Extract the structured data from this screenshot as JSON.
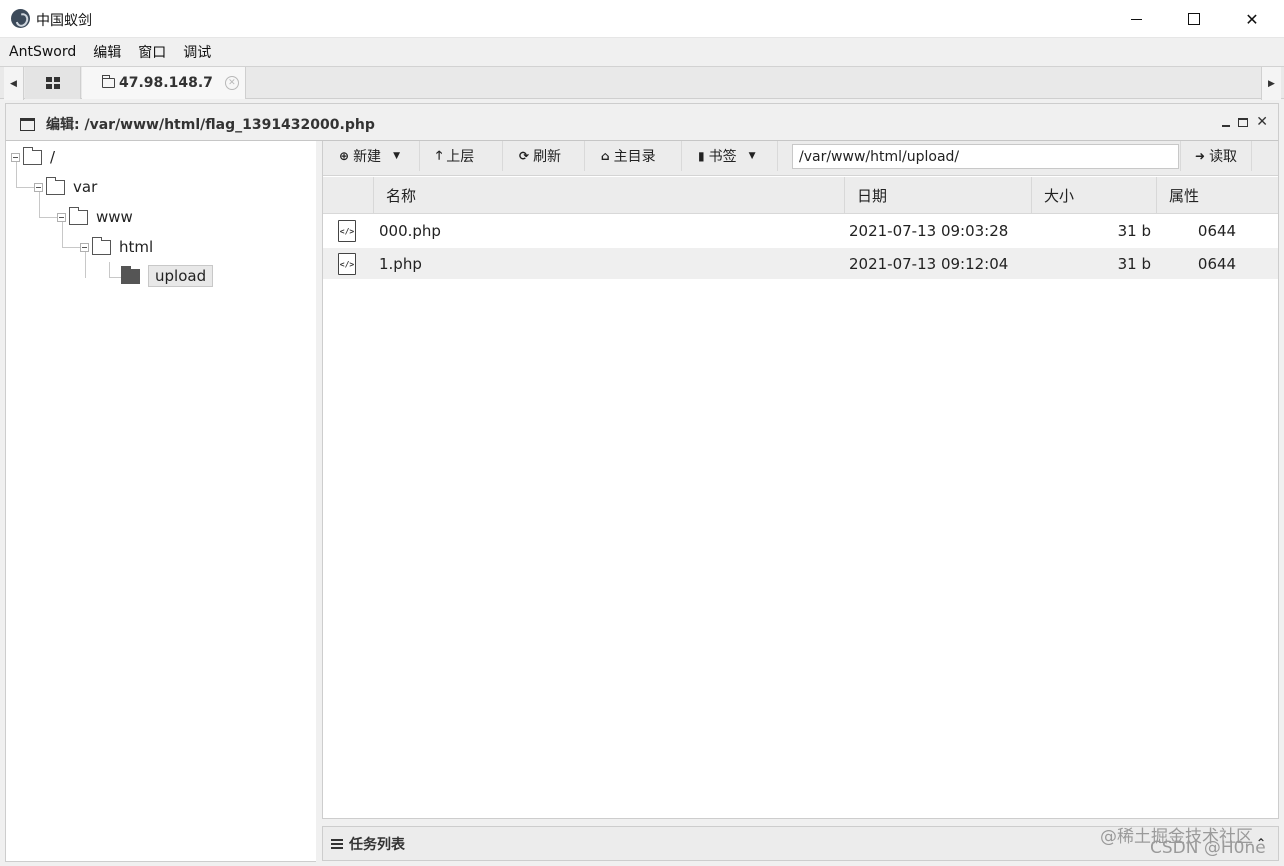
{
  "window": {
    "title": "中国蚁剑"
  },
  "menu": [
    "AntSword",
    "编辑",
    "窗口",
    "调试"
  ],
  "tabs": {
    "active_label": "47.98.148.7"
  },
  "panel": {
    "title": "编辑: /var/www/html/flag_1391432000.php"
  },
  "tree": {
    "nodes": [
      {
        "label": "/",
        "icon": "folder-icon"
      },
      {
        "label": "var",
        "icon": "folder-icon"
      },
      {
        "label": "www",
        "icon": "folder-icon"
      },
      {
        "label": "html",
        "icon": "folder-icon"
      },
      {
        "label": "upload",
        "icon": "folder-filled-icon",
        "selected": true
      }
    ]
  },
  "toolbar": {
    "new_label": "新建",
    "up_label": "上层",
    "refresh_label": "刷新",
    "home_label": "主目录",
    "bookmark_label": "书签",
    "path_value": "/var/www/html/upload/",
    "read_label": "读取"
  },
  "grid": {
    "columns": [
      "名称",
      "日期",
      "大小",
      "属性"
    ],
    "rows": [
      {
        "name": "000.php",
        "date": "2021-07-13 09:03:28",
        "size": "31 b",
        "perm": "0644"
      },
      {
        "name": "1.php",
        "date": "2021-07-13 09:12:04",
        "size": "31 b",
        "perm": "0644"
      }
    ]
  },
  "taskbar": {
    "label": "任务列表"
  },
  "watermarks": [
    "@稀土掘金技术社区",
    "CSDN @H0ne"
  ]
}
